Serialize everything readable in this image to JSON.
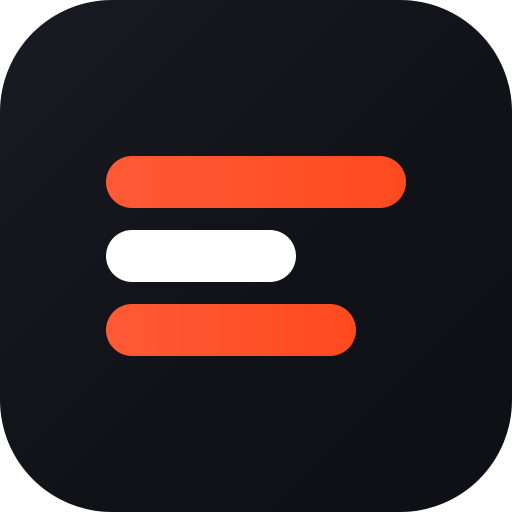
{
  "icon": {
    "name": "three-bar-logo",
    "colors": {
      "background_start": "#1a1b22",
      "background_end": "#0d0f16",
      "accent_start": "#ff5a36",
      "accent_end": "#ff4a1f",
      "neutral": "#ffffff"
    },
    "bars": [
      {
        "id": "top",
        "color": "accent"
      },
      {
        "id": "middle",
        "color": "neutral"
      },
      {
        "id": "bottom",
        "color": "accent"
      }
    ]
  }
}
